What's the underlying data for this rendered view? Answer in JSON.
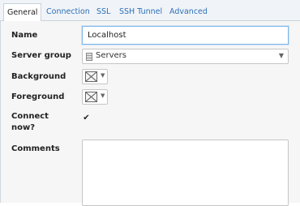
{
  "tabs": [
    {
      "label": "General",
      "active": true
    },
    {
      "label": "Connection"
    },
    {
      "label": "SSL"
    },
    {
      "label": "SSH Tunnel"
    },
    {
      "label": "Advanced"
    }
  ],
  "form": {
    "name_label": "Name",
    "name_value": "Localhost",
    "server_group_label": "Server group",
    "server_group_value": "Servers",
    "server_group_icon": "server-group-icon",
    "background_label": "Background",
    "foreground_label": "Foreground",
    "connect_now_label_line1": "Connect",
    "connect_now_label_line2": "now?",
    "connect_now_checked": true,
    "checkmark": "✔",
    "comments_label": "Comments",
    "comments_value": ""
  },
  "colors": {
    "tab_link": "#2c6fb6",
    "focus_border": "#7fb6e6",
    "panel_bg": "#f6f6f6"
  }
}
